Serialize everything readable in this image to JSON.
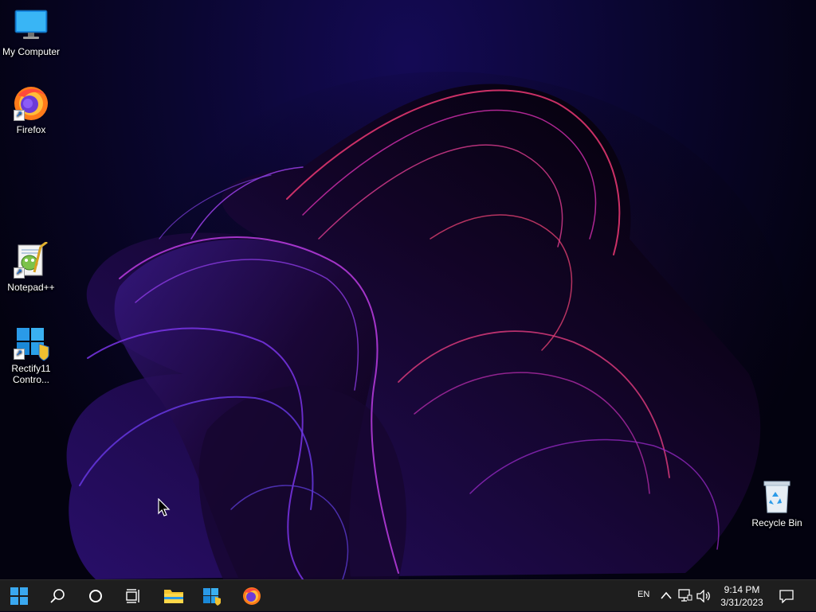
{
  "desktop": {
    "icons": [
      {
        "label": "My Computer",
        "icon": "monitor-icon"
      },
      {
        "label": "Firefox",
        "icon": "firefox-icon"
      },
      {
        "label": "Notepad++",
        "icon": "notepadpp-icon"
      },
      {
        "label": "Rectify11 Contro...",
        "icon": "rectify11-icon"
      },
      {
        "label": "Recycle Bin",
        "icon": "recycle-bin-icon"
      }
    ]
  },
  "taskbar": {
    "buttons": [
      {
        "name": "start",
        "icon": "windows-logo-icon"
      },
      {
        "name": "search",
        "icon": "search-icon"
      },
      {
        "name": "cortana",
        "icon": "circle-icon"
      },
      {
        "name": "task-view",
        "icon": "task-view-icon"
      },
      {
        "name": "file-explorer",
        "icon": "folder-icon"
      },
      {
        "name": "rectify11",
        "icon": "rectify11-icon"
      },
      {
        "name": "firefox",
        "icon": "firefox-icon"
      }
    ],
    "tray": {
      "language": "EN",
      "time": "9:14 PM",
      "date": "3/31/2023"
    }
  },
  "colors": {
    "taskbar": "#1e1e1e",
    "accent": "#0078d4",
    "wallpaper_glow": "#c02aa0"
  }
}
